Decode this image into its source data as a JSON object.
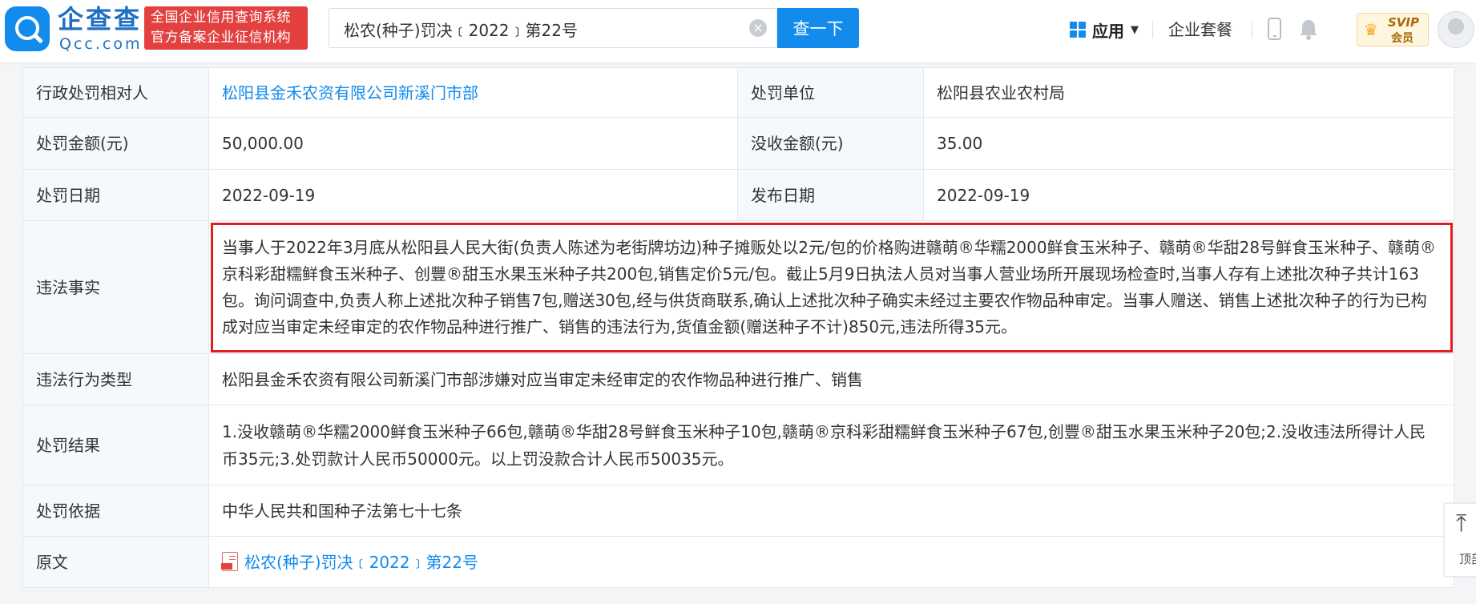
{
  "header": {
    "logo_name": "企查查",
    "logo_domain": "Qcc.com",
    "cert_line1": "全国企业信用查询系统",
    "cert_line2": "官方备案企业征信机构",
    "search_value": "松农(种子)罚决﹝2022﹞第22号",
    "search_button": "查一下",
    "apps_label": "应用",
    "package_label": "企业套餐",
    "vip_title": "SVIP",
    "vip_sub": "会员"
  },
  "rows": {
    "party_label": "行政处罚相对人",
    "party_value": "松阳县金禾农资有限公司新溪门市部",
    "unit_label": "处罚单位",
    "unit_value": "松阳县农业农村局",
    "amount_label": "处罚金额(元)",
    "amount_value": "50,000.00",
    "confiscate_label": "没收金额(元)",
    "confiscate_value": "35.00",
    "date_label": "处罚日期",
    "date_value": "2022-09-19",
    "publish_label": "发布日期",
    "publish_value": "2022-09-19",
    "facts_label": "违法事实",
    "facts_value": "当事人于2022年3月底从松阳县人民大街(负责人陈述为老街牌坊边)种子摊贩处以2元/包的价格购进赣萌®华糯2000鲜食玉米种子、赣萌®华甜28号鲜食玉米种子、赣萌®京科彩甜糯鲜食玉米种子、创豐®甜玉水果玉米种子共200包,销售定价5元/包。截止5月9日执法人员对当事人营业场所开展现场检查时,当事人存有上述批次种子共计163包。询问调查中,负责人称上述批次种子销售7包,赠送30包,经与供货商联系,确认上述批次种子确实未经过主要农作物品种审定。当事人赠送、销售上述批次种子的行为已构成对应当审定未经审定的农作物品种进行推广、销售的违法行为,货值金额(赠送种子不计)850元,违法所得35元。",
    "type_label": "违法行为类型",
    "type_value": "松阳县金禾农资有限公司新溪门市部涉嫌对应当审定未经审定的农作物品种进行推广、销售",
    "result_label": "处罚结果",
    "result_value": "1.没收赣萌®华糯2000鲜食玉米种子66包,赣萌®华甜28号鲜食玉米种子10包,赣萌®京科彩甜糯鲜食玉米种子67包,创豐®甜玉水果玉米种子20包;2.没收违法所得计人民币35元;3.处罚款计人民币50000元。以上罚没款合计人民币50035元。",
    "basis_label": "处罚依据",
    "basis_value": "中华人民共和国种子法第七十七条",
    "original_label": "原文",
    "original_value": "松农(种子)罚决﹝2022﹞第22号"
  },
  "back_top_label": "顶部",
  "colors": {
    "brand": "#128bed",
    "highlight_border": "#e02020",
    "label_bg": "#f5f8fc"
  }
}
